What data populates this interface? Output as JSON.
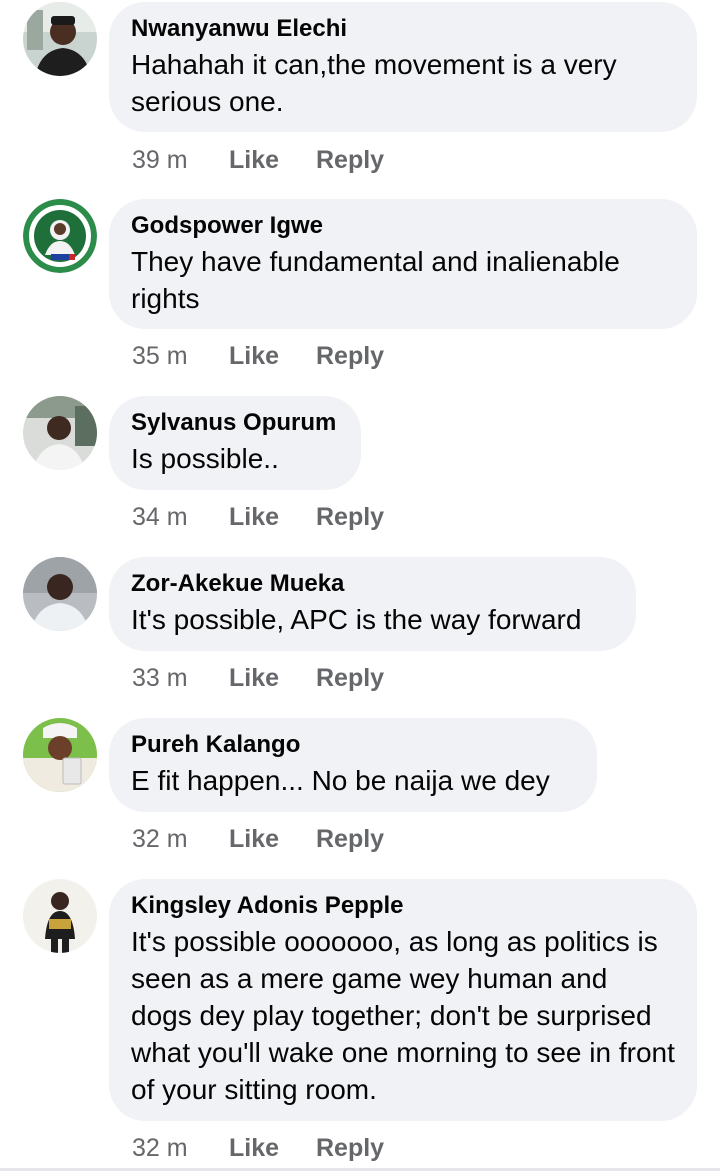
{
  "comments": [
    {
      "author": "Nwanyanwu Elechi",
      "text": "Hahahah it can,the movement is a very serious one.",
      "time": "39 m",
      "like_label": "Like",
      "reply_label": "Reply"
    },
    {
      "author": "Godspower Igwe",
      "text": "They have fundamental and inalienable rights",
      "time": "35 m",
      "like_label": "Like",
      "reply_label": "Reply"
    },
    {
      "author": "Sylvanus Opurum",
      "text": "Is possible..",
      "time": "34 m",
      "like_label": "Like",
      "reply_label": "Reply"
    },
    {
      "author": "Zor-Akekue Mueka",
      "text": "It's possible, APC is the way forward",
      "time": "33 m",
      "like_label": "Like",
      "reply_label": "Reply"
    },
    {
      "author": "Pureh Kalango",
      "text": "E fit happen... No be naija we dey",
      "time": "32 m",
      "like_label": "Like",
      "reply_label": "Reply"
    },
    {
      "author": "Kingsley Adonis Pepple",
      "text": "It's possible ooooooo, as long as politics is seen as a mere game wey human and dogs dey play together; don't be surprised what you'll wake one morning to see in front of your sitting room.",
      "time": "32 m",
      "like_label": "Like",
      "reply_label": "Reply"
    }
  ],
  "avatar_icons": [
    "user-photo-icon",
    "campaign-logo-icon",
    "user-photo-icon",
    "user-photo-icon",
    "user-photo-icon",
    "user-photo-icon"
  ],
  "colors": {
    "bubble_background": "#f0f2f5",
    "text": "#050505",
    "secondary_text": "#65676b"
  }
}
